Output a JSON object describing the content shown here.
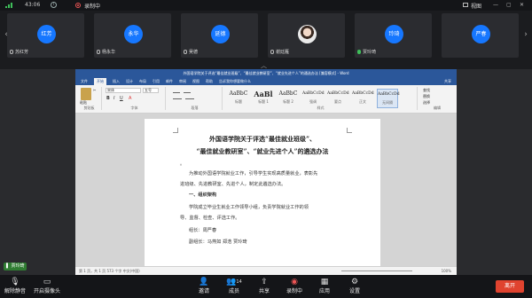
{
  "topbar": {
    "time": "43:06",
    "recording_label": "录制中",
    "view_label": "视图"
  },
  "participants": [
    {
      "avatar": "红芳",
      "name": "苏红芳",
      "mic": "muted"
    },
    {
      "avatar": "永华",
      "name": "杨永华",
      "mic": "muted"
    },
    {
      "avatar": "延德",
      "name": "吴德",
      "mic": "muted"
    },
    {
      "avatar": "",
      "name": "谢廷雁",
      "mic": "muted"
    },
    {
      "avatar": "玲琦",
      "name": "贾玲琦",
      "mic": "active"
    },
    {
      "avatar": "严春",
      "name": "",
      "mic": ""
    }
  ],
  "word": {
    "title": "外国语学院关于评选“最佳就业班级”、“最佳就业教研室”、“就业先进个人”的通选办法 [兼容模式] - Word",
    "tabs": [
      "文件",
      "开始",
      "插入",
      "设计",
      "布局",
      "引用",
      "邮件",
      "审阅",
      "视图",
      "帮助",
      "告诉我你想要做什么"
    ],
    "share_label": "共享",
    "ribbon_groups": {
      "clipboard": "剪贴板",
      "font": "字体",
      "paragraph": "段落",
      "styles": "样式",
      "editing": "编辑"
    },
    "paste_label": "粘贴",
    "font_name": "宋体",
    "font_size": "五号",
    "styles": [
      {
        "sample": "AaBbC",
        "name": "标题",
        "heading": false
      },
      {
        "sample": "AaBl",
        "name": "标题 1",
        "heading": true
      },
      {
        "sample": "AaBbC",
        "name": "标题 2",
        "heading": false
      },
      {
        "sample": "AaBbCcDd",
        "name": "强调",
        "heading": false
      },
      {
        "sample": "AaBbCcDd",
        "name": "要点",
        "heading": false
      },
      {
        "sample": "AaBbCcDd",
        "name": "正文",
        "heading": false
      },
      {
        "sample": "AaBbCcDd",
        "name": "无间隔",
        "heading": false
      }
    ],
    "editing": [
      "查找",
      "替换",
      "选择"
    ],
    "document": {
      "title_line1": "外国语学院关于评选“最佳就业班级”、",
      "title_line2": "“最佳就业教研室”、“就业先进个人”的遴选办法",
      "dot": "。",
      "p1": "为推动外国语学院就业工作，引导学生实现高质量就业，表彰先",
      "p2": "进班级、先进教研室、先进个人，制定此遴选办法。",
      "h1": "一、组织架构",
      "p3": "学院成立毕业生就业工作领导小组，负责学院就业工作的领",
      "p4": "导、监督、检查、评选工作。",
      "p5": "组长：周严春",
      "p6": "副组长：马燕如 郑浩 贾玲琦"
    },
    "status_left": "第 1 页，共 1 页    573 个字    中文(中国)",
    "zoom": "100%"
  },
  "speaker": "贾玲琦",
  "toolbar": {
    "mute": "解除静音",
    "camera": "开启摄像头",
    "invite": "邀请",
    "members": "成员",
    "member_count": "14",
    "share": "共享",
    "record": "录制中",
    "apps": "应用",
    "settings": "设置",
    "leave": "离开"
  }
}
